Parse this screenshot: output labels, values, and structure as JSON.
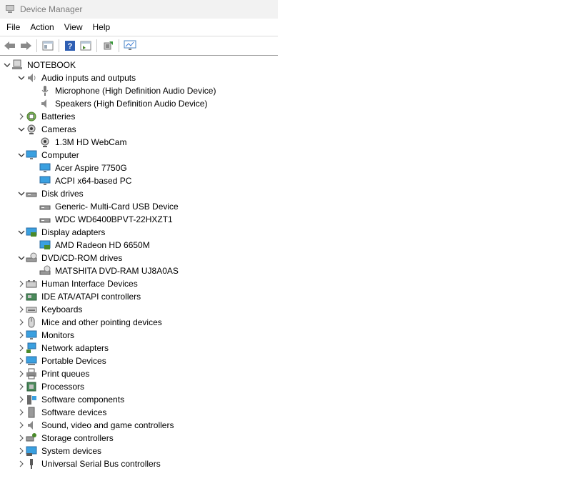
{
  "window": {
    "title": "Device Manager"
  },
  "menu": [
    "File",
    "Action",
    "View",
    "Help"
  ],
  "toolbar": [
    "back-icon",
    "forward-icon",
    "properties-icon",
    "help-icon",
    "show-hidden-icon",
    "scan-hardware-icon",
    "monitor-icon"
  ],
  "tree": {
    "root": "NOTEBOOK",
    "categories": [
      {
        "label": "Audio inputs and outputs",
        "expanded": true,
        "icon": "audio-icon",
        "children": [
          {
            "label": "Microphone (High Definition Audio Device)",
            "icon": "microphone-icon"
          },
          {
            "label": "Speakers (High Definition Audio Device)",
            "icon": "speaker-icon"
          }
        ]
      },
      {
        "label": "Batteries",
        "expanded": false,
        "icon": "battery-icon"
      },
      {
        "label": "Cameras",
        "expanded": true,
        "icon": "camera-icon",
        "children": [
          {
            "label": "1.3M HD WebCam",
            "icon": "camera-icon"
          }
        ]
      },
      {
        "label": "Computer",
        "expanded": true,
        "icon": "computer-icon",
        "children": [
          {
            "label": "Acer Aspire 7750G",
            "icon": "computer-icon"
          },
          {
            "label": "ACPI x64-based PC",
            "icon": "computer-icon"
          }
        ]
      },
      {
        "label": "Disk drives",
        "expanded": true,
        "icon": "disk-icon",
        "children": [
          {
            "label": "Generic- Multi-Card USB Device",
            "icon": "disk-icon"
          },
          {
            "label": "WDC WD6400BPVT-22HXZT1",
            "icon": "disk-icon"
          }
        ]
      },
      {
        "label": "Display adapters",
        "expanded": true,
        "icon": "display-adapter-icon",
        "children": [
          {
            "label": "AMD Radeon HD 6650M",
            "icon": "display-adapter-icon"
          }
        ]
      },
      {
        "label": "DVD/CD-ROM drives",
        "expanded": true,
        "icon": "dvd-icon",
        "children": [
          {
            "label": "MATSHITA DVD-RAM UJ8A0AS",
            "icon": "dvd-icon"
          }
        ]
      },
      {
        "label": "Human Interface Devices",
        "expanded": false,
        "icon": "hid-icon"
      },
      {
        "label": "IDE ATA/ATAPI controllers",
        "expanded": false,
        "icon": "ide-icon"
      },
      {
        "label": "Keyboards",
        "expanded": false,
        "icon": "keyboard-icon"
      },
      {
        "label": "Mice and other pointing devices",
        "expanded": false,
        "icon": "mouse-icon"
      },
      {
        "label": "Monitors",
        "expanded": false,
        "icon": "monitor-icon"
      },
      {
        "label": "Network adapters",
        "expanded": false,
        "icon": "network-icon"
      },
      {
        "label": "Portable Devices",
        "expanded": false,
        "icon": "portable-icon"
      },
      {
        "label": "Print queues",
        "expanded": false,
        "icon": "printer-icon"
      },
      {
        "label": "Processors",
        "expanded": false,
        "icon": "processor-icon"
      },
      {
        "label": "Software components",
        "expanded": false,
        "icon": "software-component-icon"
      },
      {
        "label": "Software devices",
        "expanded": false,
        "icon": "software-device-icon"
      },
      {
        "label": "Sound, video and game controllers",
        "expanded": false,
        "icon": "sound-icon"
      },
      {
        "label": "Storage controllers",
        "expanded": false,
        "icon": "storage-icon"
      },
      {
        "label": "System devices",
        "expanded": false,
        "icon": "system-icon"
      },
      {
        "label": "Universal Serial Bus controllers",
        "expanded": false,
        "icon": "usb-icon"
      }
    ]
  }
}
